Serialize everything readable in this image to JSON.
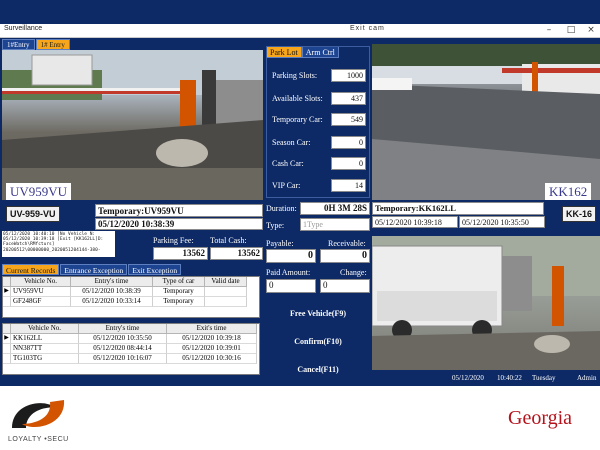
{
  "window": {
    "title": "Surveillance",
    "camera_title": "Exit cam"
  },
  "entry_tabs": [
    "1#Entry",
    "1# Entry"
  ],
  "entry": {
    "plate_big": "UV959VU",
    "plate_image": "UV-959-VU",
    "record_label": "Temporary:UV959VU",
    "record_time": "05/12/2020 10:38:39"
  },
  "exit": {
    "plate_big": "KK162",
    "plate_image": "KK-16",
    "record_label": "Temporary:KK162LL",
    "entry_time": "05/12/2020 10:39:18",
    "exit_time": "05/12/2020 10:35:50"
  },
  "parking_tabs": [
    "Park Lot",
    "Arm Ctrl"
  ],
  "parking": {
    "slots_label": "Parking Slots:",
    "slots": "1000",
    "available_label": "Available Slots:",
    "available": "437",
    "temporary_label": "Temporary Car:",
    "temporary": "549",
    "season_label": "Season Car:",
    "season": "0",
    "cash_label": "Cash Car:",
    "cash": "0",
    "vip_label": "VIP Car:",
    "vip": "14"
  },
  "payment": {
    "duration_label": "Duration:",
    "duration": "0H 3M 28S",
    "type_label": "Type:",
    "type_placeholder": "1Type",
    "payable_label": "Payable:",
    "payable": "0",
    "receivable_label": "Receivable:",
    "receivable": "0",
    "paid_label": "Paid Amount:",
    "paid": "0",
    "change_label": "Change:",
    "change": "0",
    "parking_fee_label": "Parking Fee:",
    "parking_fee": "13562",
    "total_cash_label": "Total Cash:",
    "total_cash": "13562"
  },
  "log_lines": [
    "05/12/2020 10:40:10 [No Vehicle N:",
    "05/12/2020 10:39:18 [Exit [KK162LL]D:",
    "FaceWatch\\RMfcturs]",
    "20200512\\00000000_2020051204144-380-"
  ],
  "records_tabs": [
    "Current Records",
    "Entrance Exception",
    "Exit Exception"
  ],
  "current_records": {
    "headers": [
      "Vehicle No.",
      "Entry's time",
      "Type of car",
      "Valid date"
    ],
    "rows": [
      [
        "UV959VU",
        "05/12/2020 10:38:39",
        "Temporary",
        ""
      ],
      [
        "GF248GF",
        "05/12/2020 10:33:14",
        "Temporary",
        ""
      ]
    ]
  },
  "exit_records": {
    "headers": [
      "Vehicle No.",
      "Entry's time",
      "Exit's time"
    ],
    "rows": [
      [
        "KK162LL",
        "05/12/2020 10:35:50",
        "05/12/2020 10:39:18"
      ],
      [
        "NN387TT",
        "05/12/2020 08:44:14",
        "05/12/2020 10:39:01"
      ],
      [
        "TG103TG",
        "05/12/2020 10:16:07",
        "05/12/2020 10:30:16"
      ]
    ]
  },
  "buttons": {
    "free_vehicle": "Free Vehicle(F9)",
    "confirm": "Confirm(F10)",
    "cancel": "Cancel(F11)"
  },
  "status": {
    "date": "05/12/2020",
    "time": "10:40:22",
    "day": "Tuesday",
    "user": "Admin"
  },
  "branding": {
    "logo_text": "LOYALTY •SECU",
    "country": "Georgia"
  },
  "colors": {
    "window_bg": "#0d2a66",
    "tab_active": "#f7a61b",
    "country_red": "#b5121b"
  }
}
